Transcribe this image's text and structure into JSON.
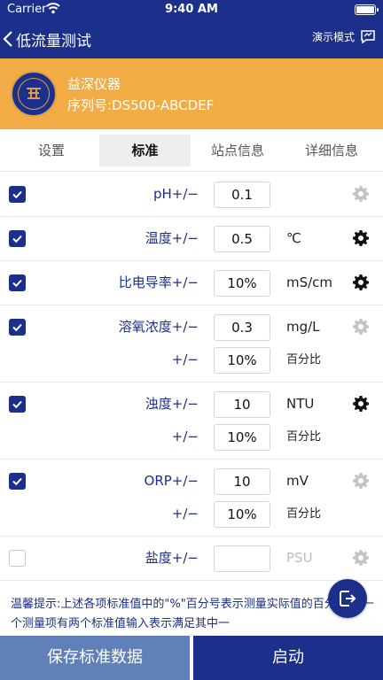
{
  "status_bar": {
    "carrier": "Carrier",
    "time": "9:40 AM"
  },
  "nav": {
    "title": "低流量测试",
    "demo_mode": "演示模式"
  },
  "company": {
    "name": "益深仪器",
    "serial": "序列号:DS500-ABCDEF"
  },
  "tabs": [
    {
      "label": "设置",
      "active": false
    },
    {
      "label": "标准",
      "active": true
    },
    {
      "label": "站点信息",
      "active": false
    },
    {
      "label": "详细信息",
      "active": false
    }
  ],
  "rows": [
    {
      "checked": true,
      "label": "pH+/−",
      "value": "0.1",
      "unit": "",
      "gear_active": false
    },
    {
      "checked": true,
      "label": "温度+/−",
      "value": "0.5",
      "unit": "℃",
      "gear_active": true
    },
    {
      "checked": true,
      "label": "比电导率+/−",
      "value": "10%",
      "unit": "mS/cm",
      "gear_active": true
    },
    {
      "checked": true,
      "label": "溶氧浓度+/−",
      "value": "0.3",
      "unit": "mg/L",
      "gear_active": false,
      "sub": {
        "label": "+/−",
        "value": "10%",
        "unit": "百分比"
      }
    },
    {
      "checked": true,
      "label": "浊度+/−",
      "value": "10",
      "unit": "NTU",
      "gear_active": true,
      "sub": {
        "label": "+/−",
        "value": "10%",
        "unit": "百分比"
      }
    },
    {
      "checked": true,
      "label": "ORP+/−",
      "value": "10",
      "unit": "mV",
      "gear_active": false,
      "sub": {
        "label": "+/−",
        "value": "10%",
        "unit": "百分比"
      }
    },
    {
      "checked": false,
      "label": "盐度+/−",
      "value": "",
      "unit": "PSU",
      "gear_active": false
    }
  ],
  "tip": "温馨提示:上述各项标准值中的\"%\"百分号表示测量实际值的百分比,同一个测量项有两个标准值输入表示满足其中一",
  "buttons": {
    "save": "保存标准数据",
    "start": "启动"
  },
  "colors": {
    "primary": "#1c2f8a",
    "header_orange": "#f1ac45",
    "save_button": "#5f80b9",
    "gear_active": "#111111",
    "gear_inactive": "#c4c4c4"
  },
  "icons": {
    "back": "chevron-left-icon",
    "demo": "chat-bubble-icon",
    "gear": "gear-icon",
    "check": "checkmark-icon",
    "exit": "logout-icon"
  }
}
